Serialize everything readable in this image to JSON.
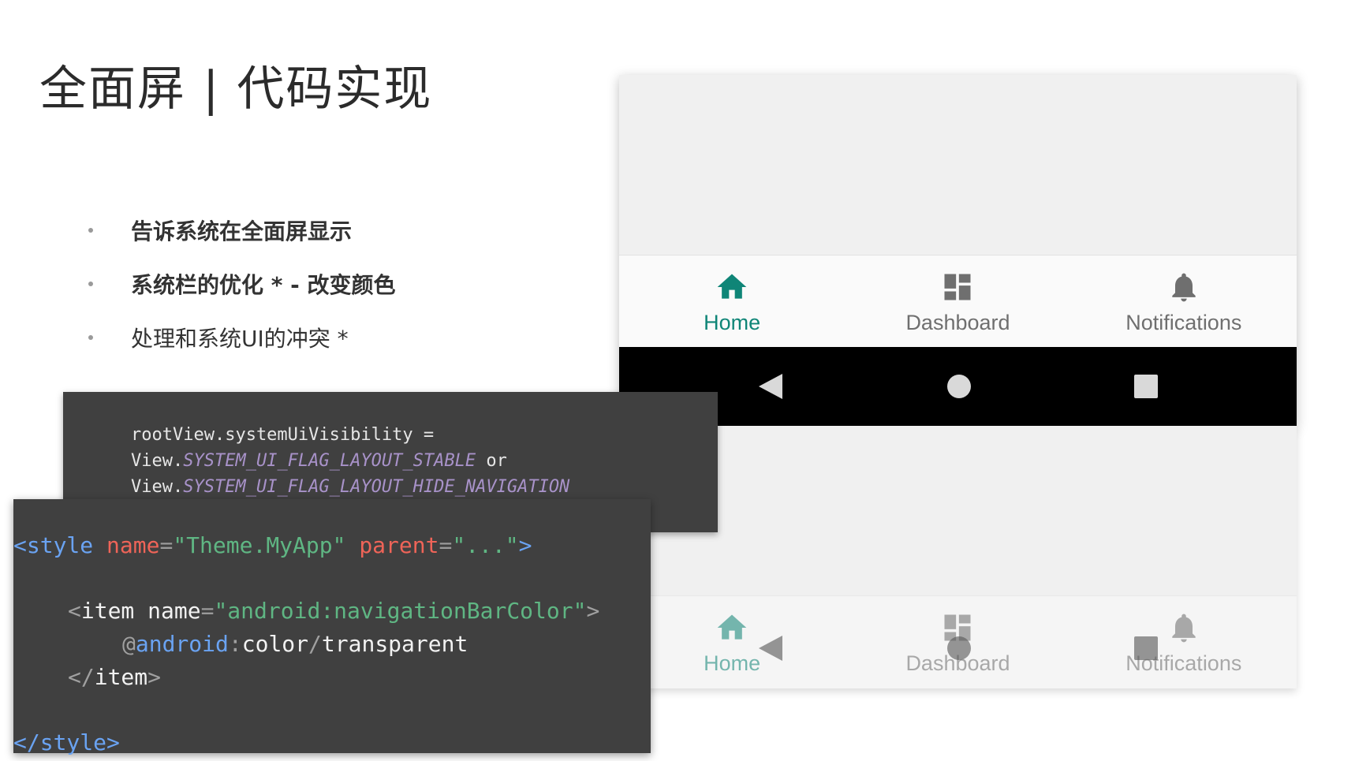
{
  "slide": {
    "title": "全面屏 | 代码实现",
    "bullets": [
      {
        "text": "告诉系统在全面屏显示",
        "bold": true
      },
      {
        "text": "系统栏的优化 * - 改变颜色",
        "bold": true
      },
      {
        "text": "处理和系统UI的冲突 *",
        "bold": false
      }
    ]
  },
  "phone": {
    "tabs": [
      {
        "label": "Home",
        "icon": "home-icon",
        "active": true
      },
      {
        "label": "Dashboard",
        "icon": "dashboard-icon",
        "active": false
      },
      {
        "label": "Notifications",
        "icon": "bell-icon",
        "active": false
      }
    ],
    "system_buttons": [
      "back-icon",
      "home-circle-icon",
      "recents-icon"
    ],
    "colors": {
      "accent": "#0f8577",
      "inactive": "#6f6f6f",
      "sysbar": "#000000"
    }
  },
  "code_kotlin": {
    "line1": "rootView.systemUiVisibility =",
    "line2_prefix": "View.",
    "line2_flag": "SYSTEM_UI_FLAG_LAYOUT_STABLE",
    "line2_suffix": " or",
    "line3_prefix": "View.",
    "line3_flag": "SYSTEM_UI_FLAG_LAYOUT_HIDE_NAVIGATION"
  },
  "code_xml": {
    "open_tag": "<style",
    "name_attr": "name",
    "eq": "=",
    "name_value": "\"Theme.MyApp\"",
    "parent_attr": "parent",
    "parent_value": "\"...\"",
    "open_tag_end": ">",
    "item_open": "<",
    "item_tag": "item",
    "item_name_attr": " name",
    "item_name_value": "\"android:navigationBarColor\"",
    "item_open_end": ">",
    "value_at": "@",
    "value_pkg": "android",
    "value_colon": ":",
    "value_type": "color",
    "value_slash": "/",
    "value_name": "transparent",
    "item_close_lt": "</",
    "item_close_tag": "item",
    "item_close_gt": ">",
    "close_tag": "</style>"
  }
}
